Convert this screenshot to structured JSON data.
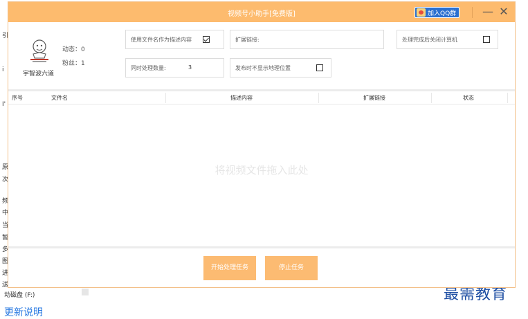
{
  "window": {
    "title": "视频号小助手[免费版]",
    "qq_group_label": "加入QQ群",
    "minimize_glyph": "—",
    "close_glyph": "✕"
  },
  "profile": {
    "name": "宇智波六道",
    "posts_label": "动态：0",
    "fans_label": "粉丝：1"
  },
  "options": {
    "use_filename_label": "使用文件名作为描述内容",
    "use_filename_checked": true,
    "extend_link_label": "扩展链接:",
    "extend_link_value": "",
    "shutdown_label": "处理完成后关闭计算机",
    "shutdown_checked": false,
    "concurrency_label": "同时处理数量:",
    "concurrency_value": "3",
    "hide_location_label": "发布时不显示地理位置",
    "hide_location_checked": false
  },
  "table": {
    "columns": [
      "序号",
      "文件名",
      "描述内容",
      "扩展链接",
      "状态"
    ],
    "drop_hint": "将视频文件拖入此处"
  },
  "actions": {
    "start_label": "开始处理任务",
    "stop_label": "停止任务"
  },
  "background": {
    "drive_label": "动磁盘 (F:)",
    "bottom_link": "更新说明",
    "watermark": "最需教育"
  },
  "colors": {
    "accent": "#fdbb6e",
    "qq_blue": "#2a6fd0"
  }
}
